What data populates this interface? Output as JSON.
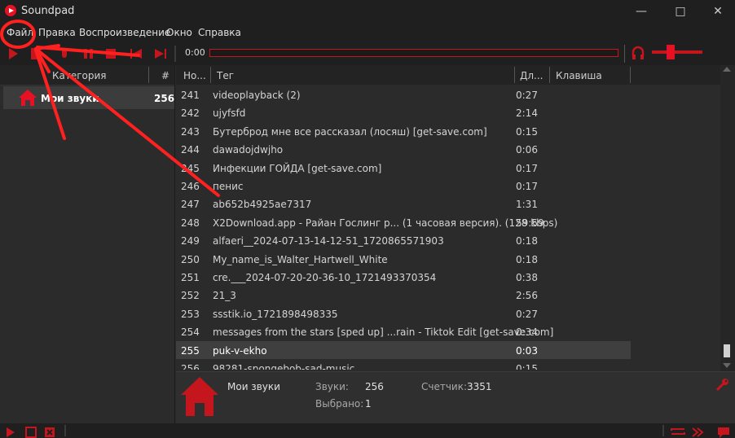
{
  "window": {
    "title": "Soundpad"
  },
  "menu": [
    "Файл",
    "Правка",
    "Воспроизведение",
    "Окно",
    "Справка"
  ],
  "player": {
    "time": "0:00"
  },
  "categories_table": {
    "headers": {
      "category": "Категория",
      "count": "#"
    },
    "rows": [
      {
        "name": "Мои звуки",
        "count": "256"
      }
    ]
  },
  "sounds_table": {
    "headers": {
      "number": "Но...",
      "tag": "Тег",
      "duration": "Дл...",
      "hotkey": "Клавиша"
    },
    "rows": [
      {
        "n": "241",
        "tag": "videoplayback (2)",
        "dur": "0:27"
      },
      {
        "n": "242",
        "tag": "ujyfsfd",
        "dur": "2:14"
      },
      {
        "n": "243",
        "tag": "Бутерброд мне все рассказал (лосяш) [get-save.com]",
        "dur": "0:15"
      },
      {
        "n": "244",
        "tag": "dawadojdwjho",
        "dur": "0:06"
      },
      {
        "n": "245",
        "tag": "Инфекции ГОЙДА [get-save.com]",
        "dur": "0:17"
      },
      {
        "n": "246",
        "tag": "пенис",
        "dur": "0:17"
      },
      {
        "n": "247",
        "tag": "ab652b4925ae7317",
        "dur": "1:31"
      },
      {
        "n": "248",
        "tag": "X2Download.app - Райан Гослинг р... (1 часовая версия). (128 kbps)",
        "dur": "59:59"
      },
      {
        "n": "249",
        "tag": "alfaeri__2024-07-13-14-12-51_1720865571903",
        "dur": "0:18"
      },
      {
        "n": "250",
        "tag": "My_name_is_Walter_Hartwell_White",
        "dur": "0:18"
      },
      {
        "n": "251",
        "tag": "cre.___2024-07-20-20-36-10_1721493370354",
        "dur": "0:38"
      },
      {
        "n": "252",
        "tag": "21_3",
        "dur": "2:56"
      },
      {
        "n": "253",
        "tag": "ssstik.io_1721898498335",
        "dur": "0:27"
      },
      {
        "n": "254",
        "tag": "messages from the stars [sped up] ...rain - Tiktok Edit [get-save.com]",
        "dur": "0:34"
      },
      {
        "n": "255",
        "tag": "puk-v-ekho",
        "dur": "0:03"
      },
      {
        "n": "256",
        "tag": "98281-spongebob-sad-music",
        "dur": "0:15"
      }
    ],
    "selected_number": "255"
  },
  "info": {
    "name": "Мои звуки",
    "sounds_label": "Звуки:",
    "sounds_value": "256",
    "counter_label": "Счетчик:",
    "counter_value": "3351",
    "selected_label": "Выбрано:",
    "selected_value": "1"
  },
  "colors": {
    "accent": "#e81123",
    "annotation": "#ff2020"
  }
}
